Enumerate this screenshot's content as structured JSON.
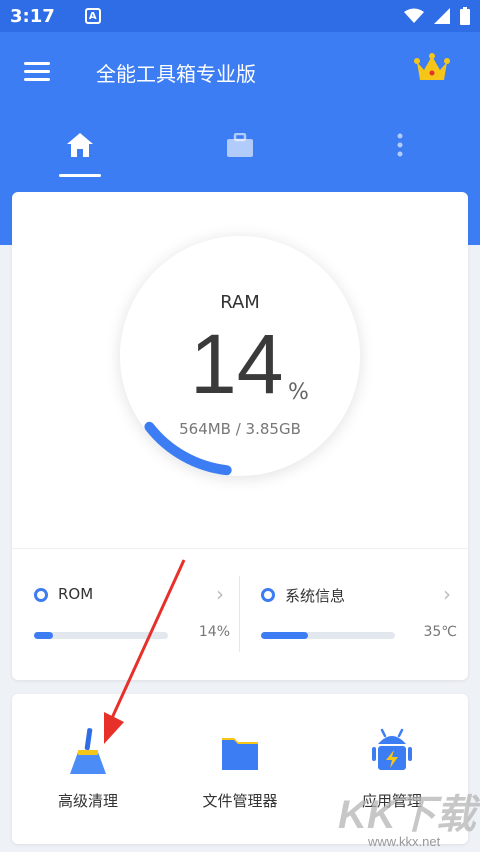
{
  "status_bar": {
    "time": "3:17",
    "app_badge": "A"
  },
  "app_bar": {
    "title": "全能工具箱专业版"
  },
  "tabs": [
    {
      "icon": "home-icon",
      "selected": true
    },
    {
      "icon": "briefcase-icon",
      "selected": false
    },
    {
      "icon": "more-vertical-icon",
      "selected": false
    }
  ],
  "ram": {
    "label": "RAM",
    "percent": "14",
    "unit": "%",
    "detail": "564MB / 3.85GB",
    "usage_fraction": 0.14
  },
  "stats": {
    "rom": {
      "label": "ROM",
      "value": "14%",
      "fill_fraction": 0.14
    },
    "system": {
      "label": "系统信息",
      "value": "35℃",
      "fill_fraction": 0.35
    }
  },
  "tools": [
    {
      "label": "高级清理",
      "icon": "broom-icon"
    },
    {
      "label": "文件管理器",
      "icon": "folder-icon"
    },
    {
      "label": "应用管理",
      "icon": "android-icon"
    }
  ],
  "watermark": {
    "logo_text": "KK下载",
    "url": "www.kkx.net"
  },
  "colors": {
    "primary": "#3d7df4",
    "status_bar": "#2f6de6",
    "annotation_arrow": "#e8302a",
    "crown": "#f5c518"
  }
}
